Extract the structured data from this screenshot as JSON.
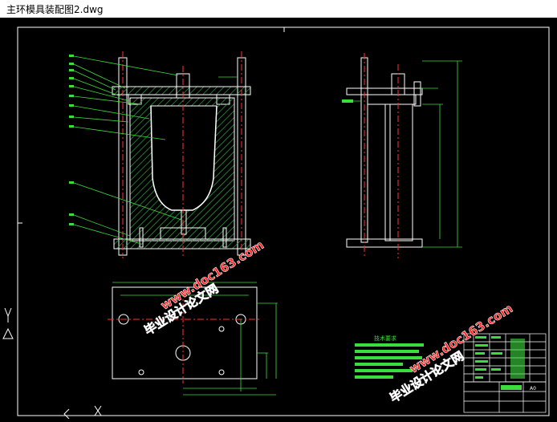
{
  "window": {
    "title": "主环模具装配图2.dwg"
  },
  "drawing": {
    "watermark_site": "www.doc163.com",
    "watermark_name": "毕业设计论文网",
    "tech_req_heading": "技术要求",
    "title_block_code": "A0"
  },
  "colors": {
    "background": "#000000",
    "outline": "#ffffff",
    "hatch": "#2fa84a",
    "dimension": "#3ddc3d",
    "centerline": "#ff3333",
    "watermark": "#ff2020"
  }
}
